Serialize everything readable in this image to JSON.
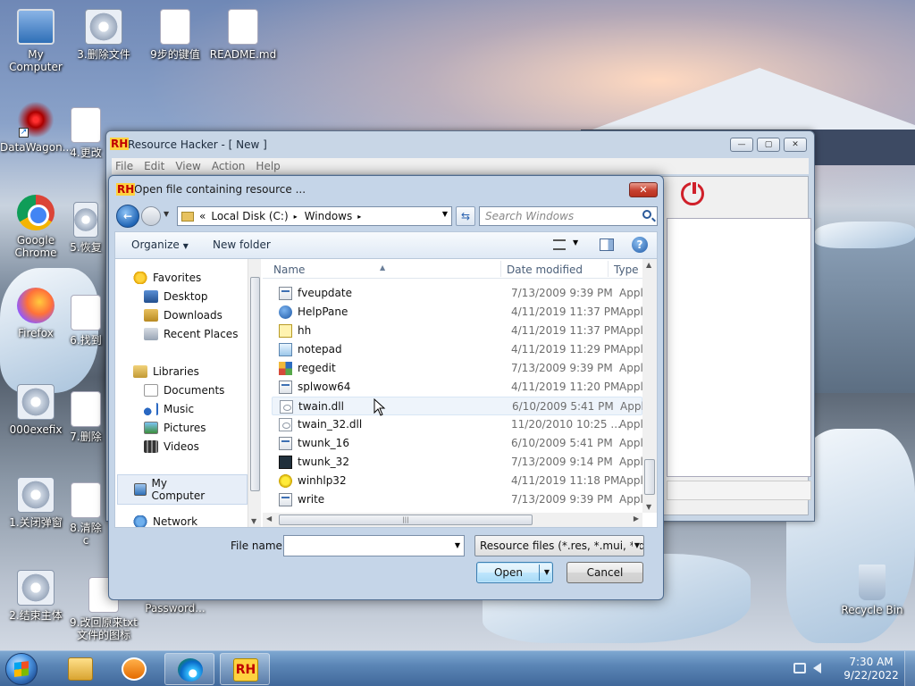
{
  "desktop": {
    "icons": [
      {
        "label": "My Computer"
      },
      {
        "label": "3.删除文件"
      },
      {
        "label": "9步的键值"
      },
      {
        "label": "README.md"
      },
      {
        "label": "DataWagon..."
      },
      {
        "label": "4.更改"
      },
      {
        "label": "Google Chrome"
      },
      {
        "label": "5.恢复"
      },
      {
        "label": "Firefox"
      },
      {
        "label": "6.找到"
      },
      {
        "label": "000exefix"
      },
      {
        "label": "7.删除"
      },
      {
        "label": "1.关闭弹窗"
      },
      {
        "label": "8.清除c"
      },
      {
        "label": "2.结束主体"
      },
      {
        "label": "9.改回原来txt文件的图标"
      },
      {
        "label": "Password..."
      },
      {
        "label": "Recycle Bin"
      }
    ]
  },
  "rh_window": {
    "title": "Resource Hacker - [ New ]",
    "menu": [
      "File",
      "Edit",
      "View",
      "Action",
      "Help"
    ],
    "controls": {
      "minimize": "—",
      "maximize": "▢",
      "close": "✕"
    }
  },
  "dialog": {
    "title": "Open file containing resource ...",
    "close": "✕",
    "address": {
      "prefix": "«",
      "crumbs": [
        "Local Disk (C:)",
        "Windows"
      ],
      "separator": "▸"
    },
    "search_placeholder": "Search Windows",
    "toolbar": {
      "organize": "Organize",
      "new_folder": "New folder",
      "help": "?"
    },
    "nav": {
      "favorites": "Favorites",
      "desktop": "Desktop",
      "downloads": "Downloads",
      "recent": "Recent Places",
      "libraries": "Libraries",
      "documents": "Documents",
      "music": "Music",
      "pictures": "Pictures",
      "videos": "Videos",
      "computer": "My Computer",
      "network": "Network"
    },
    "columns": {
      "name": "Name",
      "date": "Date modified",
      "type": "Type"
    },
    "files": [
      {
        "name": "fveupdate",
        "date": "7/13/2009 9:39 PM",
        "type": "Applic"
      },
      {
        "name": "HelpPane",
        "date": "4/11/2019 11:37 PM",
        "type": "Applic"
      },
      {
        "name": "hh",
        "date": "4/11/2019 11:37 PM",
        "type": "Applic"
      },
      {
        "name": "notepad",
        "date": "4/11/2019 11:29 PM",
        "type": "Applic"
      },
      {
        "name": "regedit",
        "date": "7/13/2009 9:39 PM",
        "type": "Applic"
      },
      {
        "name": "splwow64",
        "date": "4/11/2019 11:20 PM",
        "type": "Applic"
      },
      {
        "name": "twain.dll",
        "date": "6/10/2009 5:41 PM",
        "type": "Applic"
      },
      {
        "name": "twain_32.dll",
        "date": "11/20/2010 10:25 ...",
        "type": "Applic"
      },
      {
        "name": "twunk_16",
        "date": "6/10/2009 5:41 PM",
        "type": "Applic"
      },
      {
        "name": "twunk_32",
        "date": "7/13/2009 9:14 PM",
        "type": "Applic"
      },
      {
        "name": "winhlp32",
        "date": "4/11/2019 11:18 PM",
        "type": "Applic"
      },
      {
        "name": "write",
        "date": "7/13/2009 9:39 PM",
        "type": "Applic"
      }
    ],
    "file_name_label": "File name:",
    "file_name_value": "",
    "file_type": "Resource files (*.res, *.mui, *.dll",
    "open_label": "Open",
    "cancel_label": "Cancel"
  },
  "taskbar": {
    "time": "7:30 AM",
    "date": "9/22/2022",
    "rh_label": "RH"
  }
}
